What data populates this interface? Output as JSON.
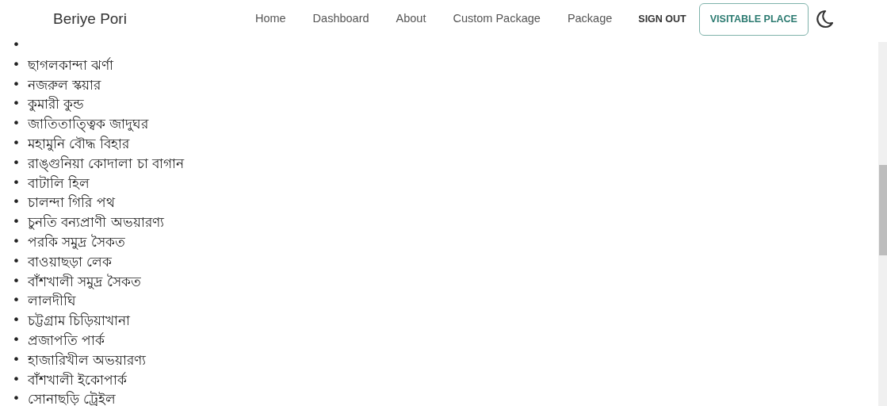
{
  "navbar": {
    "brand": "Beriye Pori",
    "links": [
      "Home",
      "Dashboard",
      "About",
      "Custom Package",
      "Package"
    ],
    "sign_out": "SIGN OUT",
    "cta": "VISITABLE PLACE"
  },
  "places": [
    {
      "marker": "•"
    },
    {
      "marker": "•",
      "text": "ছাগলকান্দা ঝর্ণা"
    },
    {
      "marker": "•",
      "text": "নজরুল স্কয়ার"
    },
    {
      "marker": "•",
      "text": "কুমারী কুন্ড"
    },
    {
      "marker": "•",
      "text": "জাতিতাত্ত্বিক জাদুঘর"
    },
    {
      "marker": "•",
      "text": "মহামুনি বৌদ্ধ বিহার"
    },
    {
      "marker": "•",
      "text": "রাঙ্গুনিয়া কোদালা চা বাগান"
    },
    {
      "marker": "•",
      "text": "বাটালি হিল"
    },
    {
      "marker": "•",
      "text": "চালন্দা গিরি পথ"
    },
    {
      "marker": "•",
      "text": "চুনতি বন্যপ্রাণী অভয়ারণ্য"
    },
    {
      "marker": "•",
      "text": "পরকি সমুদ্র সৈকত"
    },
    {
      "marker": "•",
      "text": "বাওয়াছড়া লেক"
    },
    {
      "marker": "•",
      "text": "বাঁশখালী সমুদ্র সৈকত"
    },
    {
      "marker": "•",
      "text": "লালদীঘি"
    },
    {
      "marker": "•",
      "text": "চট্টগ্রাম চিড়িয়াখানা"
    },
    {
      "marker": "•",
      "text": "প্রজাপতি পার্ক"
    },
    {
      "marker": "•",
      "text": "হাজারিখীল অভয়ারণ্য"
    },
    {
      "marker": "•",
      "text": "বাঁশখালী ইকোপার্ক"
    },
    {
      "marker": "•",
      "text": "সোনাছড়ি ট্রেইল"
    }
  ]
}
